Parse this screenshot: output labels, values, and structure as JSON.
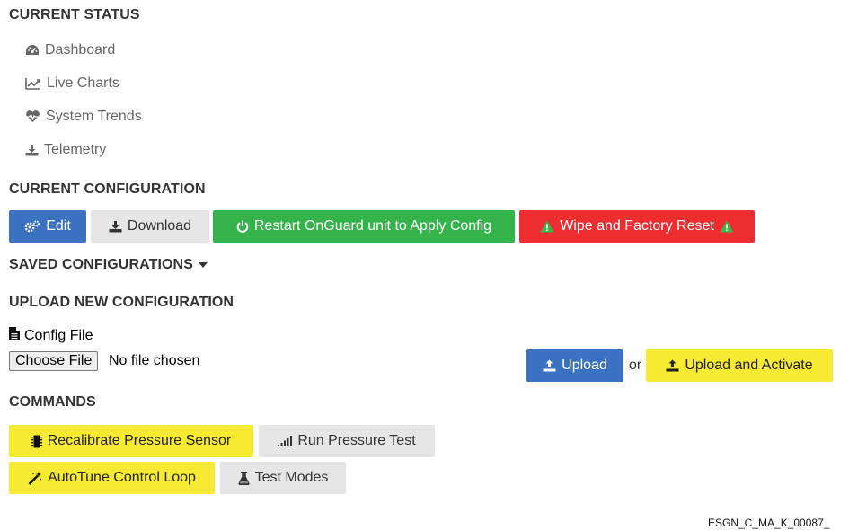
{
  "status": {
    "heading": "CURRENT STATUS",
    "items": [
      {
        "label": "Dashboard",
        "icon": "tachometer-icon"
      },
      {
        "label": "Live Charts",
        "icon": "line-chart-icon"
      },
      {
        "label": "System Trends",
        "icon": "heartbeat-icon"
      },
      {
        "label": "Telemetry",
        "icon": "download-icon"
      }
    ]
  },
  "configuration": {
    "heading": "CURRENT CONFIGURATION",
    "edit_label": "Edit",
    "download_label": "Download",
    "restart_label": "Restart OnGuard unit to Apply Config",
    "reset_label": "Wipe and Factory Reset"
  },
  "saved": {
    "heading": "SAVED CONFIGURATIONS"
  },
  "upload": {
    "heading": "UPLOAD NEW CONFIGURATION",
    "file_label": "Config File",
    "choose_label": "Choose File",
    "no_file_text": "No file chosen",
    "upload_label": "Upload",
    "or_text": "or",
    "upload_activate_label": "Upload and Activate"
  },
  "commands": {
    "heading": "COMMANDS",
    "recalibrate_label": "Recalibrate Pressure Sensor",
    "pressure_test_label": "Run Pressure Test",
    "autotune_label": "AutoTune Control Loop",
    "test_modes_label": "Test Modes"
  },
  "footer": {
    "code": "ESGN_C_MA_K_00087_"
  },
  "colors": {
    "blue": "#3a72c1",
    "gray": "#e6e6e6",
    "green": "#33b349",
    "red": "#ee2d31",
    "yellow": "#f6ea32"
  }
}
